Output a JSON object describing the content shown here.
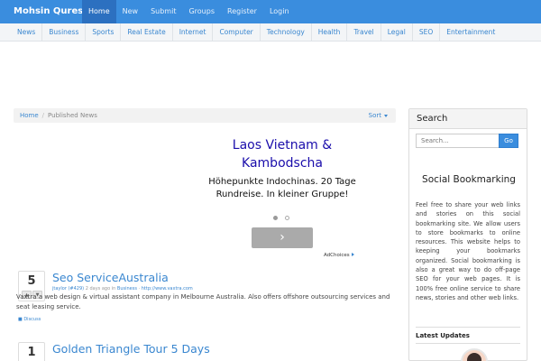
{
  "navbar": {
    "brand": "Mohsin Qureshi",
    "links": [
      "Home",
      "New",
      "Submit",
      "Groups",
      "Register",
      "Login"
    ],
    "active_index": 0
  },
  "categories": [
    "News",
    "Business",
    "Sports",
    "Real Estate",
    "Internet",
    "Computer",
    "Technology",
    "Health",
    "Travel",
    "Legal",
    "SEO",
    "Entertainment"
  ],
  "breadcrumb": {
    "home": "Home",
    "current": "Published News",
    "sort": "Sort"
  },
  "ad": {
    "title": "Laos Vietnam & Kambodscha",
    "description": "Höhepunkte Indochinas. 20 Tage Rundreise. In kleiner Gruppe!",
    "next_symbol": "›",
    "adchoices": "AdChoices"
  },
  "stories": [
    {
      "votes": "5",
      "title": "Seo ServiceAustralia",
      "meta_user": "jtaylor (#429)",
      "meta_time": "2 days ago in",
      "meta_category": "Business",
      "meta_url": "http://www.vaxtra.com",
      "body": "Vaxtra a web design & virtual assistant company in Melbourne Australia. Also offers offshore outsourcing services and seat leasing service.",
      "discuss": "Discuss"
    },
    {
      "votes": "1",
      "title": "Golden Triangle Tour 5 Days",
      "meta_user": "",
      "meta_time": "",
      "meta_category": "",
      "meta_url": "",
      "body": "",
      "discuss": ""
    }
  ],
  "sidebar": {
    "search_heading": "Search",
    "search_placeholder": "Search...",
    "search_button": "Go",
    "about_title": "Social Bookmarking",
    "about_text": "Feel free to share your web links and stories on this social bookmarking site. We allow users to store bookmarks to online resources. This website helps to keeping your bookmarks organized. Social bookmarking is also a great way to do off-page SEO for your web pages. It is 100% free online service to share news, stories and other web links.",
    "latest_heading": "Latest Updates"
  },
  "colors": {
    "accent": "#3a8dde",
    "link": "#3a87d0",
    "ad_title": "#1a0dab"
  }
}
